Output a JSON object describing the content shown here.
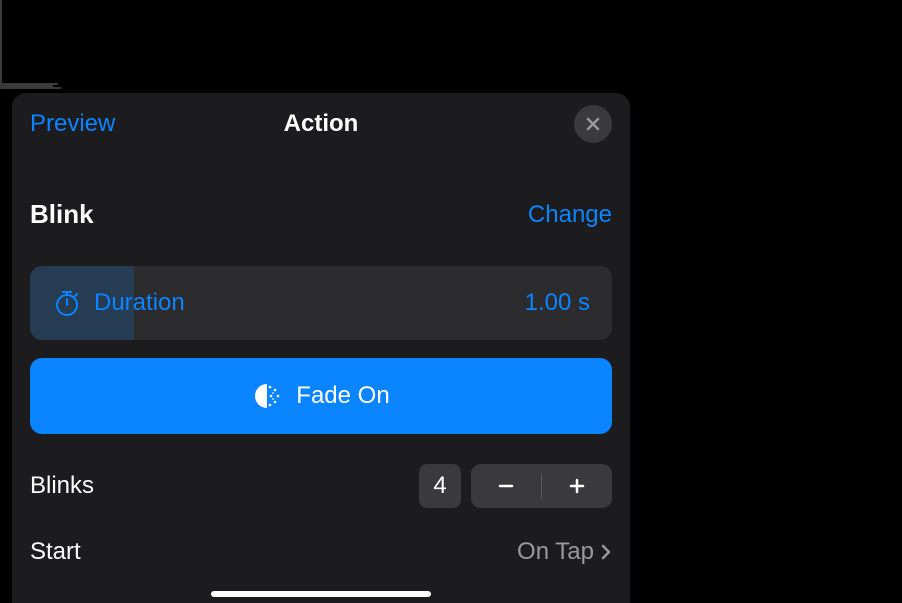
{
  "header": {
    "preview": "Preview",
    "title": "Action",
    "close_icon": "close"
  },
  "effect": {
    "name": "Blink",
    "change": "Change"
  },
  "duration": {
    "label": "Duration",
    "value": "1.00 s"
  },
  "fade": {
    "label": "Fade On"
  },
  "blinks": {
    "label": "Blinks",
    "value": "4"
  },
  "start": {
    "label": "Start",
    "value": "On Tap"
  },
  "colors": {
    "accent": "#0a84ff",
    "background": "#1c1c1e",
    "cell": "#2c2c2e",
    "control": "#3a3a3c",
    "secondary_text": "#98989d"
  }
}
